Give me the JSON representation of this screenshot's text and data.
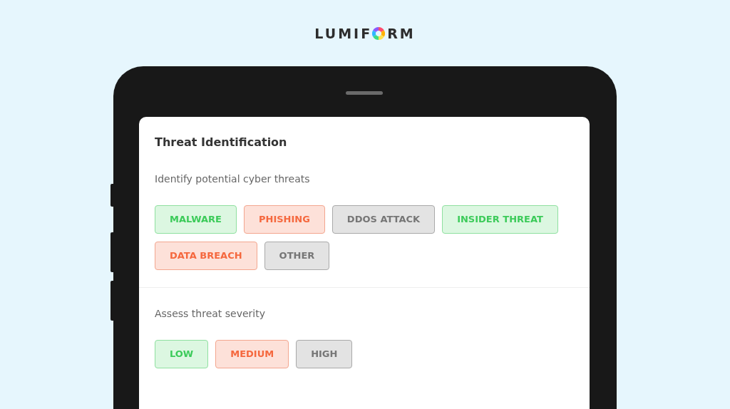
{
  "logo": {
    "before": "LUMIF",
    "after": "RM"
  },
  "card": {
    "title": "Threat Identification"
  },
  "sections": [
    {
      "prompt": "Identify potential cyber threats",
      "options": [
        {
          "label": "MALWARE",
          "color": "#3ccb5a"
        },
        {
          "label": "PHISHING",
          "color": "#f5683e"
        },
        {
          "label": "DDOS ATTACK",
          "color": "#767676"
        },
        {
          "label": "INSIDER THREAT",
          "color": "#3ccb5a"
        },
        {
          "label": "DATA BREACH",
          "color": "#f5683e"
        },
        {
          "label": "OTHER",
          "color": "#767676"
        }
      ]
    },
    {
      "prompt": "Assess threat severity",
      "options": [
        {
          "label": "LOW",
          "color": "#3ccb5a"
        },
        {
          "label": "MEDIUM",
          "color": "#f5683e"
        },
        {
          "label": "HIGH",
          "color": "#767676"
        }
      ]
    }
  ]
}
